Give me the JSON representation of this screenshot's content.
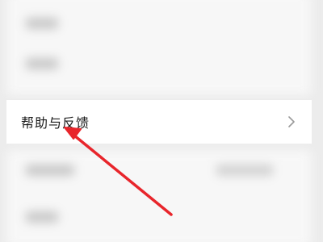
{
  "menu": {
    "help_feedback_label": "帮助与反馈"
  },
  "annotation": {
    "arrow_color": "#e8252b",
    "arrow_icon": "annotation-arrow-icon"
  },
  "colors": {
    "background": "#ececec",
    "card": "#ffffff",
    "chevron": "#9a9a9a"
  }
}
